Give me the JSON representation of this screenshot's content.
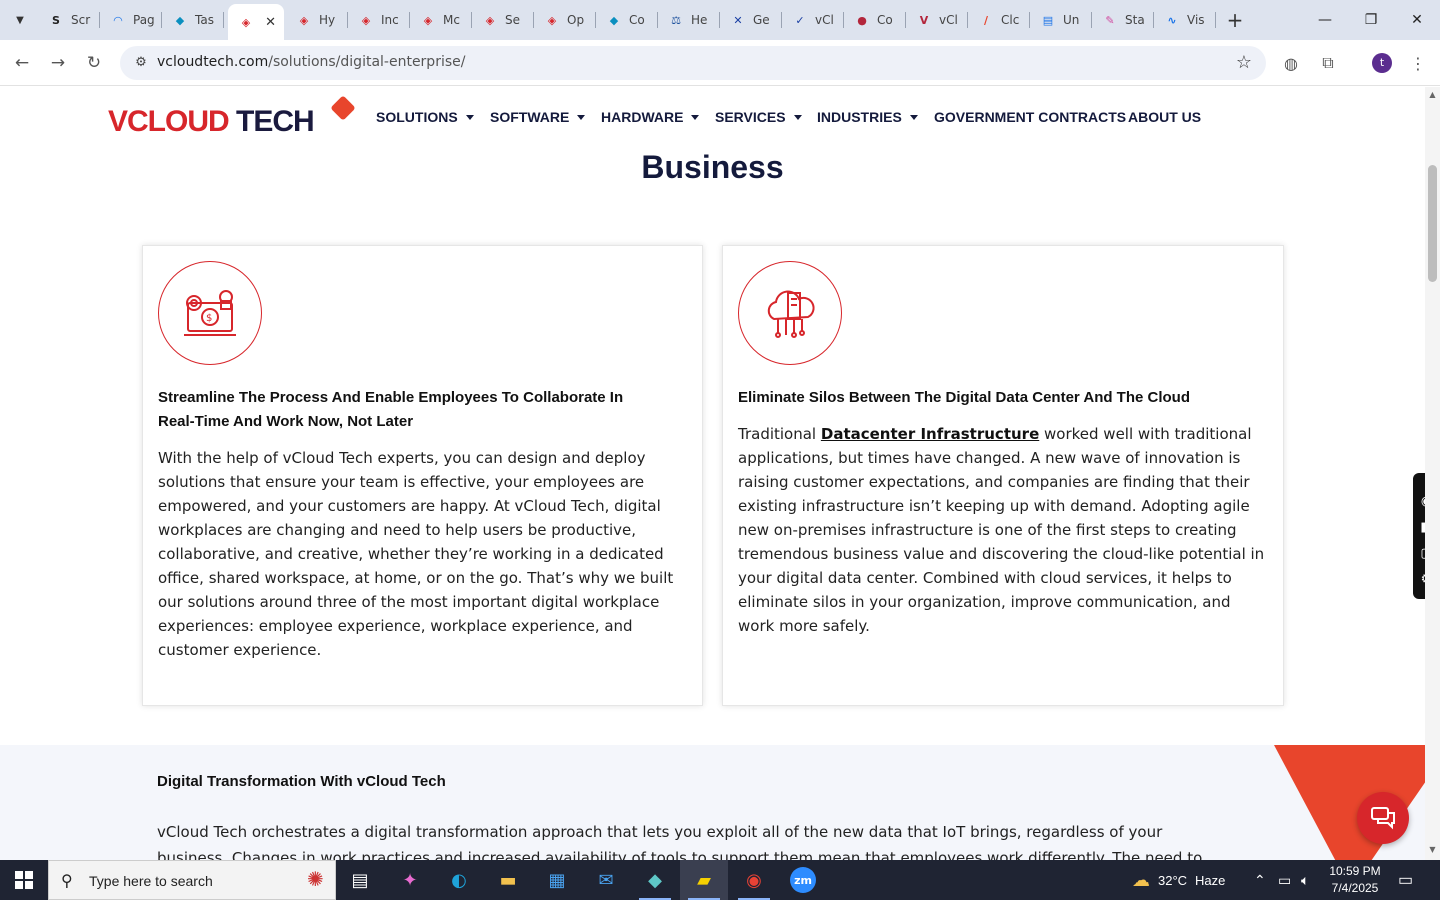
{
  "browser": {
    "tabs": [
      {
        "label": "Scr",
        "icon": "S",
        "color": "#222"
      },
      {
        "label": "Pag",
        "icon": "◠",
        "color": "#1a73e8"
      },
      {
        "label": "Tas",
        "icon": "◆",
        "color": "#0a8fbf"
      },
      {
        "label": "",
        "icon": "◈",
        "color": "#d7262b",
        "active": true
      },
      {
        "label": "Hy",
        "icon": "◈",
        "color": "#d7262b"
      },
      {
        "label": "Inc",
        "icon": "◈",
        "color": "#d7262b"
      },
      {
        "label": "Mc",
        "icon": "◈",
        "color": "#d7262b"
      },
      {
        "label": "Se",
        "icon": "◈",
        "color": "#d7262b"
      },
      {
        "label": "Op",
        "icon": "◈",
        "color": "#d7262b"
      },
      {
        "label": "Co",
        "icon": "◆",
        "color": "#0a8fbf"
      },
      {
        "label": "He",
        "icon": "⚖",
        "color": "#1a4f9c"
      },
      {
        "label": "Ge",
        "icon": "✕",
        "color": "#1a3fa3"
      },
      {
        "label": "vCl",
        "icon": "✓",
        "color": "#1a3fa3"
      },
      {
        "label": "Co",
        "icon": "●",
        "color": "#b3263c"
      },
      {
        "label": "vCl",
        "icon": "V",
        "color": "#b3263c"
      },
      {
        "label": "Clc",
        "icon": "∕",
        "color": "#e8452c"
      },
      {
        "label": "Un",
        "icon": "▤",
        "color": "#1a73e8"
      },
      {
        "label": "Sta",
        "icon": "✎",
        "color": "#d14aa0"
      },
      {
        "label": "Vis",
        "icon": "∿",
        "color": "#1a73e8"
      }
    ],
    "url_domain": "vcloudtech.com",
    "url_path": "/solutions/digital-enterprise/",
    "profile_initial": "t"
  },
  "site": {
    "logo": {
      "v": "V",
      "cloud": "CLOUD",
      "tech": " TECH"
    },
    "nav": [
      {
        "label": "SOLUTIONS",
        "dropdown": true
      },
      {
        "label": "SOFTWARE",
        "dropdown": true
      },
      {
        "label": "HARDWARE",
        "dropdown": true
      },
      {
        "label": "SERVICES",
        "dropdown": true
      },
      {
        "label": "INDUSTRIES",
        "dropdown": true
      },
      {
        "label": "GOVERNMENT CONTRACTS",
        "dropdown": false
      },
      {
        "label": "ABOUT US",
        "dropdown": false
      }
    ],
    "heading": "Business",
    "cards": [
      {
        "icon": "collaboration-icon",
        "title_line1": "Streamline The Process And Enable Employees To Collaborate In",
        "title_line2": "Real-Time And Work Now, Not Later",
        "body": "With the help of vCloud Tech experts, you can design and deploy solutions that ensure your team is effective, your employees are empowered, and your customers are happy. At vCloud Tech, digital workplaces are changing and need to help users be productive, collaborative, and creative, whether they’re working in a dedicated office, shared workspace, at home, or on the go. That’s why we built our solutions around three of the most important digital workplace experiences: employee experience, workplace experience, and customer experience."
      },
      {
        "icon": "cloud-datacenter-icon",
        "title_line1": "Eliminate Silos Between The Digital Data Center And The Cloud",
        "body_prefix": "Traditional ",
        "body_link": "Datacenter Infrastructure",
        "body_suffix": " worked well with traditional applications, but times have changed. A new wave of innovation is raising customer expectations, and companies are finding that their existing infrastructure isn’t keeping up with demand. Adopting agile new on-premises infrastructure is one of the first steps to creating tremendous business value and discovering the cloud-like potential in your digital data center. Combined with cloud services, it helps to eliminate silos in your organization, improve communication, and work more safely."
      }
    ],
    "lower": {
      "title": "Digital Transformation With vCloud Tech",
      "body": "vCloud Tech orchestrates a digital transformation approach that lets you exploit all of the new data that IoT brings, regardless of your business. Changes in work practices and increased availability of tools to support them mean that employees work differently. The need to"
    }
  },
  "taskbar": {
    "search_placeholder": "Type here to search",
    "weather_temp": "32°C",
    "weather_text": "Haze",
    "time": "10:59 PM",
    "date": "7/4/2025"
  },
  "colors": {
    "brand_red": "#d7262b",
    "navy": "#141a3c",
    "accent_orange": "#e8452c"
  }
}
